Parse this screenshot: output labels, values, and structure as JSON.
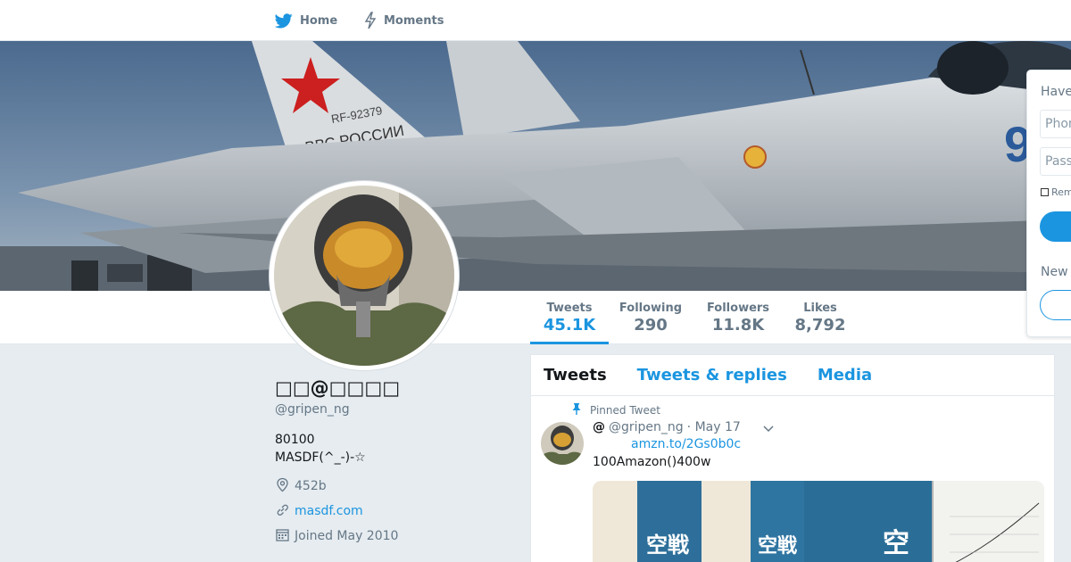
{
  "nav": {
    "home_label": "Home",
    "moments_label": "Moments"
  },
  "banner": {
    "aircraft_text1": "RF-92379",
    "aircraft_text2": "ВВС РОССИИ",
    "aircraft_number": "9"
  },
  "stats": [
    {
      "label": "Tweets",
      "value": "45.1K"
    },
    {
      "label": "Following",
      "value": "290"
    },
    {
      "label": "Followers",
      "value": "11.8K"
    },
    {
      "label": "Likes",
      "value": "8,792"
    }
  ],
  "profile": {
    "display_name": "□□@□□□□",
    "screen_name": "@gripen_ng",
    "bio_line1": "80100",
    "bio_line2": "MASDF(^_-)-☆",
    "location": "452b",
    "url": "masdf.com",
    "joined": "Joined May 2010"
  },
  "timeline": {
    "tabs": [
      "Tweets",
      "Tweets & replies",
      "Media"
    ],
    "pinned_label": "Pinned Tweet",
    "tweet": {
      "fullname": "@",
      "screen_name": "@gripen_ng",
      "time": "· May 17",
      "link": "amzn.to/2Gs0b0c",
      "text": "100Amazon()400w",
      "media_text1": "空戦",
      "media_text2": "空戦",
      "media_text3": "空"
    }
  },
  "login": {
    "prompt": "Have",
    "phone_placeholder": "Phon",
    "password_placeholder": "Pass",
    "remember_label": "Rem",
    "new_prompt": "New"
  },
  "colors": {
    "accent": "#1b95e0",
    "text_secondary": "#657786",
    "page_bg": "#e6ecf0"
  }
}
